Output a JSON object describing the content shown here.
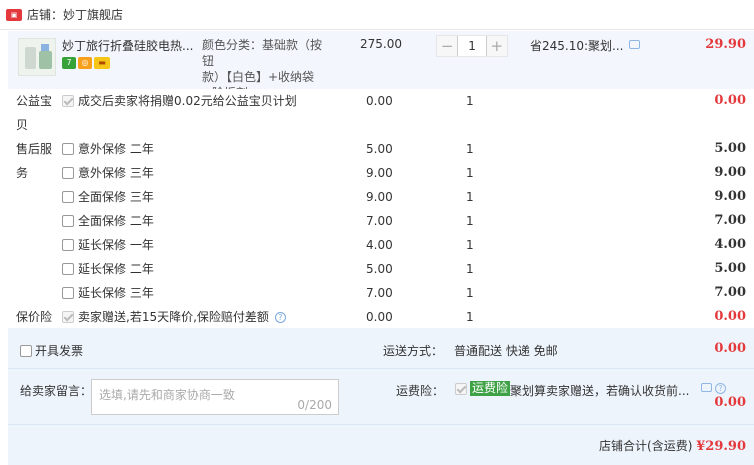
{
  "shop": {
    "label": "店铺：妙丁旗舰店",
    "icon": "shop-icon"
  },
  "item": {
    "title": "妙丁旅行折叠硅胶电热...",
    "badges": [
      "7",
      "◎",
      "▬"
    ],
    "sku_line1": "颜色分类：基础款（按钮",
    "sku_line2": "款）【白色】+收纳袋",
    "sku_line3": "+除垢剂",
    "price": "275.00",
    "qty_minus": "−",
    "qty_value": "1",
    "qty_plus": "+",
    "promo": "省245.10:聚划...",
    "subtotal": "29.90"
  },
  "services": [
    {
      "category": "公益宝",
      "name": "成交后卖家将捐赠0.02元给公益宝贝计划",
      "price": "0.00",
      "qty": "1",
      "subtotal": "0.00",
      "checked": true,
      "red": true
    },
    {
      "category": "贝",
      "name": "",
      "price": "",
      "qty": "",
      "subtotal": "",
      "checked": null,
      "red": false
    },
    {
      "category": "售后服",
      "name": "意外保修 二年",
      "price": "5.00",
      "qty": "1",
      "subtotal": "5.00",
      "checked": false,
      "red": false
    },
    {
      "category": "务",
      "name": "意外保修 三年",
      "price": "9.00",
      "qty": "1",
      "subtotal": "9.00",
      "checked": false,
      "red": false
    },
    {
      "category": "",
      "name": "全面保修 三年",
      "price": "9.00",
      "qty": "1",
      "subtotal": "9.00",
      "checked": false,
      "red": false
    },
    {
      "category": "",
      "name": "全面保修 二年",
      "price": "7.00",
      "qty": "1",
      "subtotal": "7.00",
      "checked": false,
      "red": false
    },
    {
      "category": "",
      "name": "延长保修 一年",
      "price": "4.00",
      "qty": "1",
      "subtotal": "4.00",
      "checked": false,
      "red": false
    },
    {
      "category": "",
      "name": "延长保修 二年",
      "price": "5.00",
      "qty": "1",
      "subtotal": "5.00",
      "checked": false,
      "red": false
    },
    {
      "category": "",
      "name": "延长保修 三年",
      "price": "7.00",
      "qty": "1",
      "subtotal": "7.00",
      "checked": false,
      "red": false
    },
    {
      "category": "保价险",
      "name": "卖家赠送,若15天降价,保险赔付差额",
      "price": "0.00",
      "qty": "1",
      "subtotal": "0.00",
      "checked": true,
      "red": true,
      "help": "?"
    }
  ],
  "invoice": {
    "label": "开具发票"
  },
  "shipping": {
    "label": "运送方式：",
    "value": "普通配送 快递 免邮",
    "fee": "0.00"
  },
  "memo": {
    "label": "给卖家留言：",
    "placeholder": "选填,请先和商家协商一致",
    "count": "0/200"
  },
  "insurance": {
    "label": "运费险：",
    "tag": "运费险",
    "desc": "聚划算卖家赠送，若确认收货前...",
    "help": "?",
    "fee": "0.00"
  },
  "total": {
    "label": "店铺合计(含运费)",
    "amount": "¥29.90"
  },
  "colors": {
    "accent_red": "#e4393c",
    "row_bg": "#f3f7fd",
    "bottom_bg": "#eef4fc",
    "tag_green": "#3fa146"
  }
}
